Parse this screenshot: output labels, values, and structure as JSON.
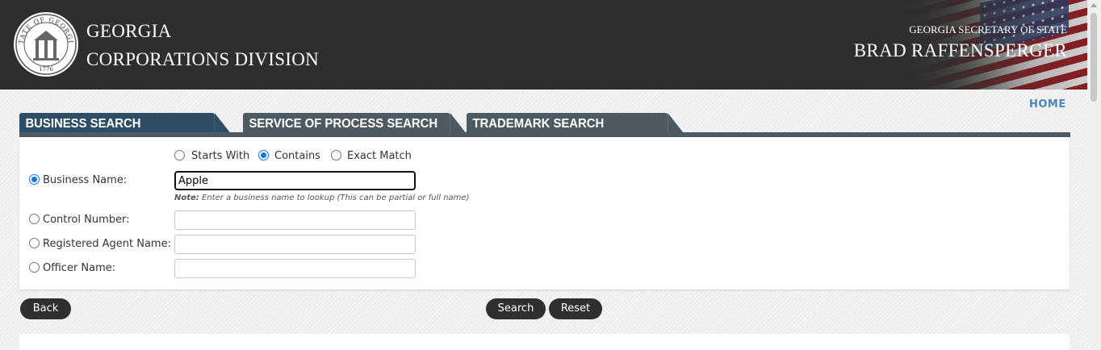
{
  "header": {
    "title_line1": "GEORGIA",
    "title_line2": "CORPORATIONS DIVISION",
    "sos_label": "GEORGIA SECRETARY OF STATE",
    "sos_name": "BRAD RAFFENSPERGER",
    "seal": {
      "text": "STATE OF GEORGIA",
      "year": "1776"
    },
    "bg_color": "#2e2e2e"
  },
  "nav": {
    "home_label": "HOME",
    "home_color": "#4b86b4"
  },
  "tabs": [
    {
      "label": "BUSINESS SEARCH",
      "active": true
    },
    {
      "label": "SERVICE OF PROCESS SEARCH",
      "active": false
    },
    {
      "label": "TRADEMARK SEARCH",
      "active": false
    }
  ],
  "search": {
    "match_options": [
      {
        "label": "Starts With",
        "selected": false
      },
      {
        "label": "Contains",
        "selected": true
      },
      {
        "label": "Exact Match",
        "selected": false
      }
    ],
    "fields": [
      {
        "label": "Business Name:",
        "selected": true,
        "value": "Apple"
      },
      {
        "label": "Control Number:",
        "selected": false,
        "value": ""
      },
      {
        "label": "Registered Agent Name:",
        "selected": false,
        "value": ""
      },
      {
        "label": "Officer Name:",
        "selected": false,
        "value": ""
      }
    ],
    "note_prefix": "Note:",
    "note_text": " Enter a business name to lookup (This can be partial or full name)"
  },
  "buttons": {
    "back": "Back",
    "search": "Search",
    "reset": "Reset"
  },
  "colors": {
    "tab_active": "#2d4e66",
    "tab_inactive": "#4e5a62",
    "radio_selected": "#1a73e8",
    "button": "#2f2f2f"
  }
}
